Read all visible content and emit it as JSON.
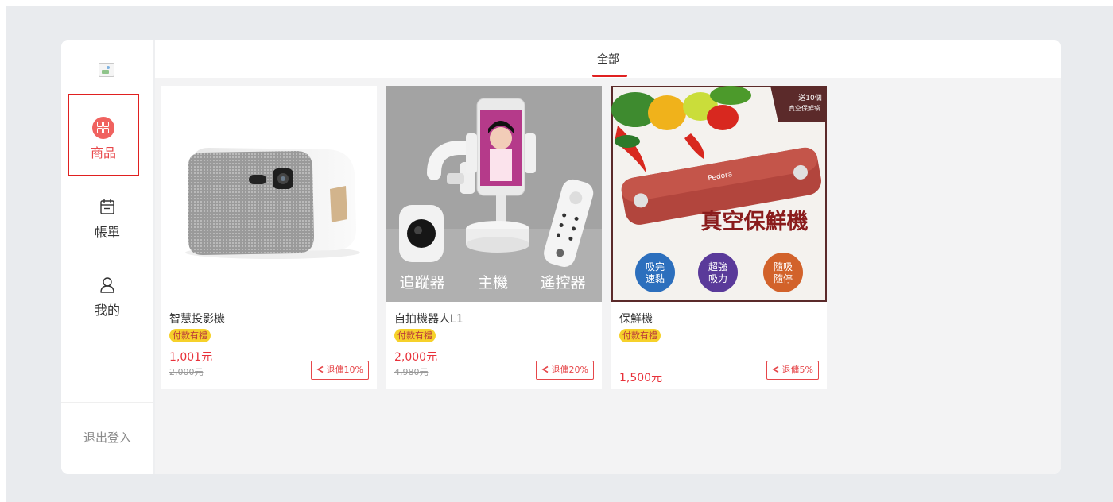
{
  "sidebar": {
    "items": [
      {
        "label": "商品",
        "icon": "grid-icon",
        "active": true
      },
      {
        "label": "帳單",
        "icon": "calendar-icon",
        "active": false
      },
      {
        "label": "我的",
        "icon": "user-icon",
        "active": false
      }
    ],
    "logout_label": "退出登入"
  },
  "tabs": [
    {
      "label": "全部",
      "active": true
    }
  ],
  "products": [
    {
      "name": "智慧投影機",
      "tag": "付款有禮",
      "price": "1,001元",
      "original_price": "2,000元",
      "share_label": "退傭10%"
    },
    {
      "name": "自拍機器人L1",
      "tag": "付款有禮",
      "price": "2,000元",
      "original_price": "4,980元",
      "share_label": "退傭20%",
      "image_labels": [
        "追蹤器",
        "主機",
        "遙控器"
      ]
    },
    {
      "name": "保鮮機",
      "tag": "付款有禮",
      "price": "1,500元",
      "share_label": "退傭5%",
      "image_title": "真空保鮮機",
      "image_corner": "送10個真空保鮮袋",
      "image_badges": [
        "吸完速黏",
        "超強吸力",
        "隨吸隨停"
      ]
    }
  ],
  "colors": {
    "accent": "#e02020",
    "price": "#e8313a",
    "tag_bg": "#f6d12a",
    "page_bg": "#e9ebee"
  }
}
